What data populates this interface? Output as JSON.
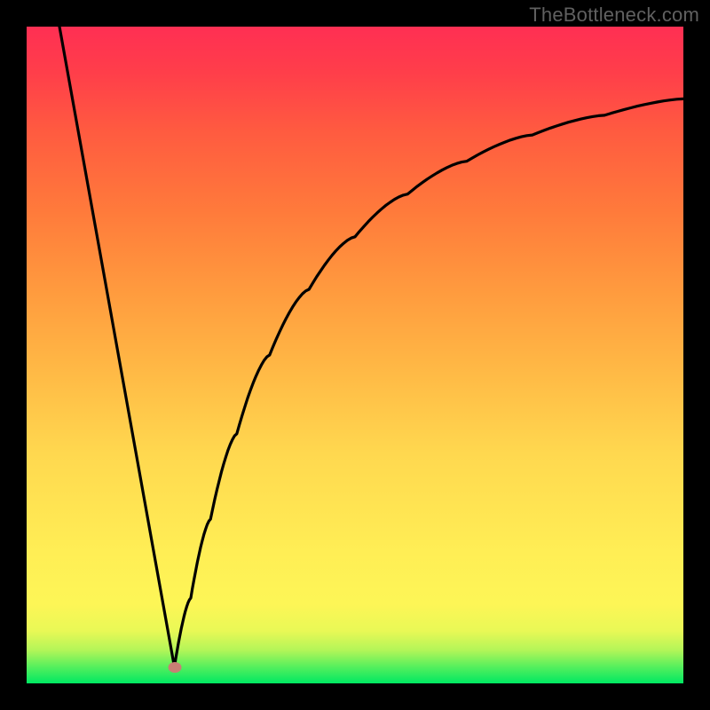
{
  "watermark": "TheBottleneck.com",
  "dot": {
    "x_pct": 22.5,
    "y_pct": 97.5
  },
  "chart_data": {
    "type": "line",
    "title": "",
    "xlabel": "",
    "ylabel": "",
    "xlim": [
      0,
      100
    ],
    "ylim": [
      0,
      100
    ],
    "grid": false,
    "legend": false,
    "background": "rainbow-vertical-gradient (green bottom → red top)",
    "series": [
      {
        "name": "left-segment",
        "x": [
          5,
          22.5
        ],
        "y": [
          100,
          2.5
        ]
      },
      {
        "name": "right-segment",
        "x": [
          22.5,
          25,
          28,
          32,
          37,
          43,
          50,
          58,
          67,
          77,
          88,
          100
        ],
        "y": [
          2.5,
          13,
          25,
          38,
          50,
          60,
          68,
          74.5,
          79.5,
          83.5,
          86.5,
          89
        ]
      }
    ],
    "marker": {
      "x": 22.5,
      "y": 2.5,
      "color": "#c97f74"
    }
  }
}
